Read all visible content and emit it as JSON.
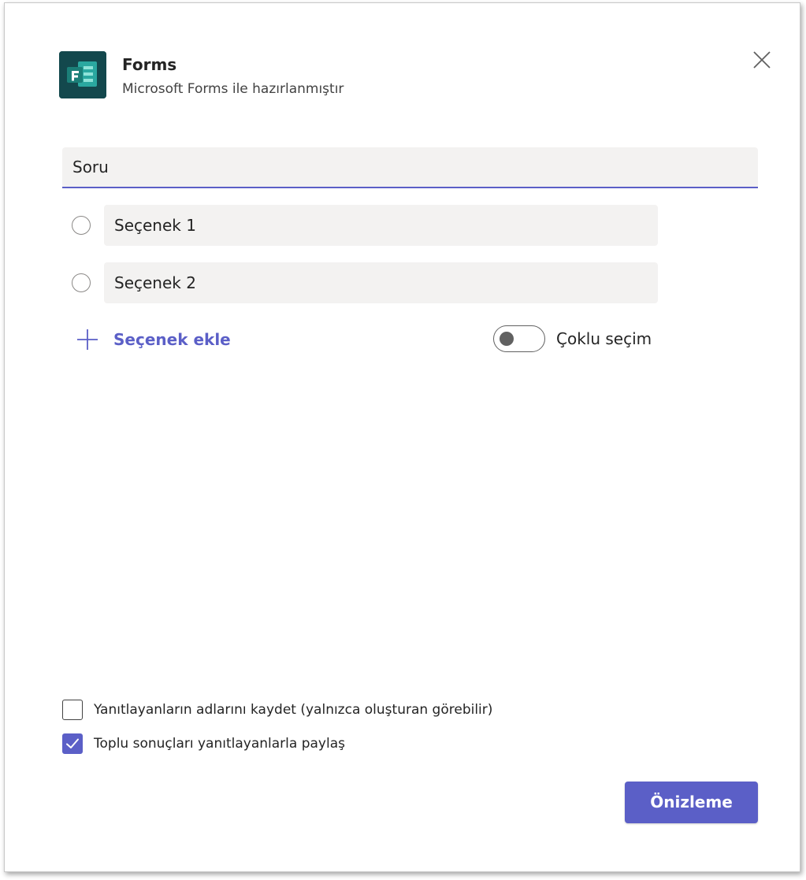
{
  "header": {
    "app_name": "Forms",
    "app_subtitle": "Microsoft Forms ile hazırlanmıştır",
    "app_icon": "forms-logo-icon",
    "close_icon": "close-icon"
  },
  "question": {
    "value": "Soru"
  },
  "options": [
    {
      "value": "Seçenek 1",
      "selected": false
    },
    {
      "value": "Seçenek 2",
      "selected": false
    }
  ],
  "add_option": {
    "label": "Seçenek ekle",
    "icon": "plus-icon"
  },
  "multi_select": {
    "label": "Çoklu seçim",
    "on": false
  },
  "settings": [
    {
      "label": "Yanıtlayanların adlarını kaydet (yalnızca oluşturan görebilir)",
      "checked": false
    },
    {
      "label": "Toplu sonuçları yanıtlayanlarla paylaş",
      "checked": true
    }
  ],
  "footer": {
    "preview_label": "Önizleme"
  },
  "colors": {
    "accent": "#5b5fc7",
    "field_bg": "#f3f2f1",
    "forms_icon_bg": "#13484d"
  }
}
